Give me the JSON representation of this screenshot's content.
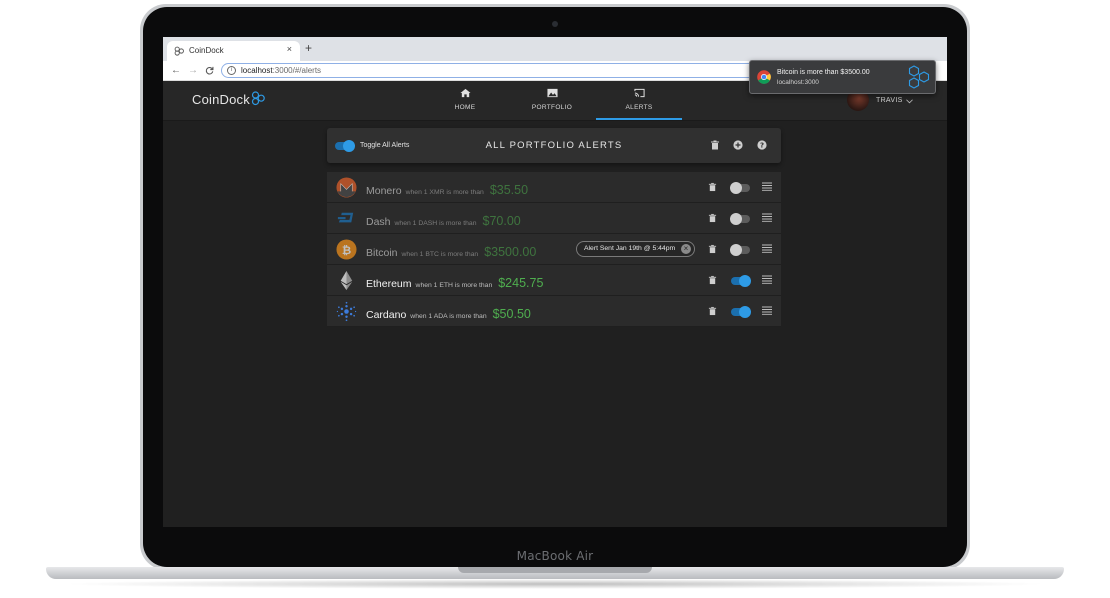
{
  "device": {
    "brand": "MacBook Air"
  },
  "browser": {
    "tab_title": "CoinDock",
    "tab_close": "×",
    "new_tab": "+",
    "url_host": "localhost",
    "url_rest": ":3000/#/alerts",
    "back": "←",
    "forward": "→",
    "reload": "C"
  },
  "nav": {
    "logo": "CoinDock",
    "tabs": [
      {
        "label": "HOME",
        "icon": "home-icon"
      },
      {
        "label": "PORTFOLIO",
        "icon": "image-icon"
      },
      {
        "label": "ALERTS",
        "icon": "cast-icon",
        "active": true
      }
    ],
    "user": "TRAVIS"
  },
  "header": {
    "toggle_all_label": "Toggle All Alerts",
    "toggle_all_on": true,
    "title": "ALL PORTFOLIO ALERTS",
    "icons": [
      "trash-icon",
      "add-circle-icon",
      "help-icon"
    ]
  },
  "alerts": [
    {
      "name": "Monero",
      "condition": "when 1 XMR is more than",
      "price": "$35.50",
      "enabled": false,
      "icon": "monero-icon"
    },
    {
      "name": "Dash",
      "condition": "when 1 DASH is more than",
      "price": "$70.00",
      "enabled": false,
      "icon": "dash-icon"
    },
    {
      "name": "Bitcoin",
      "condition": "when 1 BTC is more than",
      "price": "$3500.00",
      "enabled": false,
      "icon": "bitcoin-icon",
      "sent_chip": "Alert Sent Jan 19th @ 5:44pm"
    },
    {
      "name": "Ethereum",
      "condition": "when 1 ETH is more than",
      "price": "$245.75",
      "enabled": true,
      "icon": "ethereum-icon"
    },
    {
      "name": "Cardano",
      "condition": "when 1 ADA is more than",
      "price": "$50.50",
      "enabled": true,
      "icon": "cardano-icon"
    }
  ],
  "notification": {
    "title": "Bitcoin is more than $3500.00",
    "source": "localhost:3000"
  },
  "colors": {
    "accent": "#2e9be6",
    "price_green": "#4fae4f",
    "panel": "#303030",
    "background": "#202020"
  }
}
